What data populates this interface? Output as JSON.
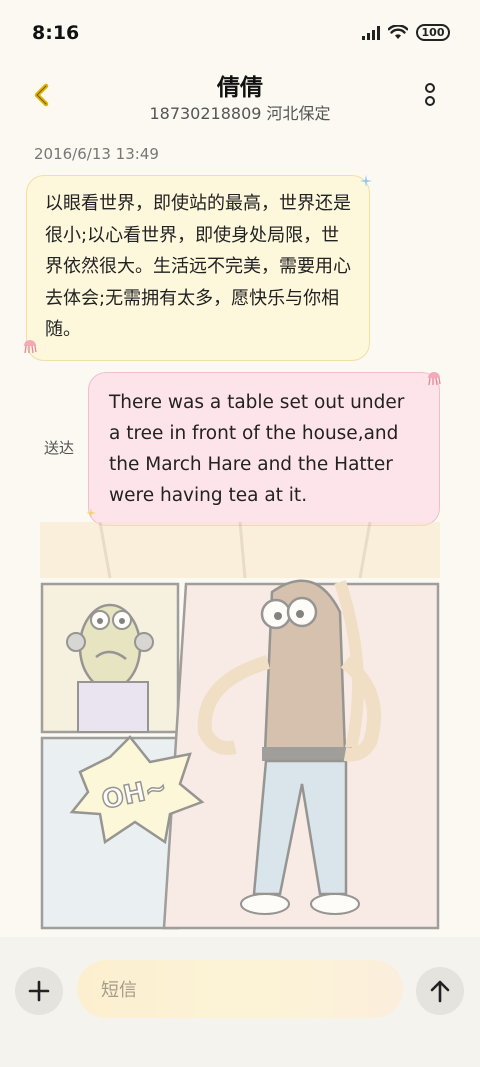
{
  "status_bar": {
    "time": "8:16",
    "battery": "100"
  },
  "header": {
    "contact_name": "倩倩",
    "contact_sub": "18730218809 河北保定"
  },
  "conversation": {
    "timestamp": "2016/6/13 13:49",
    "incoming_message": "以眼看世界，即使站的最高，世界还是很小;以心看世界，即使身处局限，世界依然很大。生活远不完美，需要用心去体会;无需拥有太多，愿快乐与你相随。",
    "outgoing_status": "送达",
    "outgoing_message": "There was a table set out under a tree in front of the house,and the March Hare and the Hatter were having tea at it."
  },
  "illustration": {
    "caption_text": "OH~"
  },
  "composer": {
    "placeholder": "短信"
  },
  "colors": {
    "background": "#fbf9f1",
    "incoming_bubble": "#fdf7dc",
    "outgoing_bubble": "#fde3ea",
    "back_icon": "#e0b400"
  },
  "icons": {
    "back": "chevron-left-icon",
    "more": "vertical-dots-icon",
    "add": "plus-icon",
    "send": "arrow-up-icon"
  }
}
